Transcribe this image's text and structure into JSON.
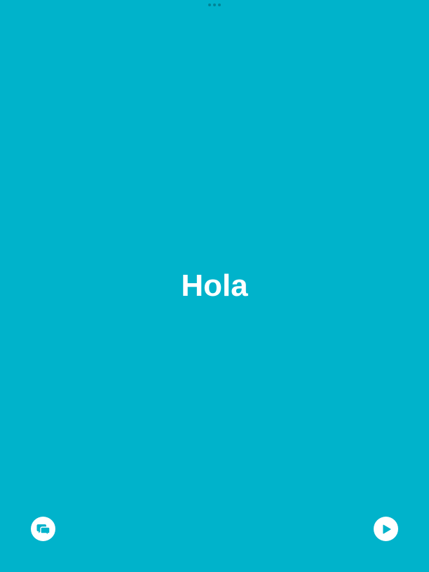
{
  "card": {
    "word": "Hola"
  },
  "controls": {
    "left_icon": "chat-bubbles-icon",
    "right_icon": "play-icon"
  },
  "colors": {
    "background": "#00b3cb",
    "text": "#ffffff",
    "button_fill": "#ffffff",
    "icon": "#00b3cb"
  }
}
